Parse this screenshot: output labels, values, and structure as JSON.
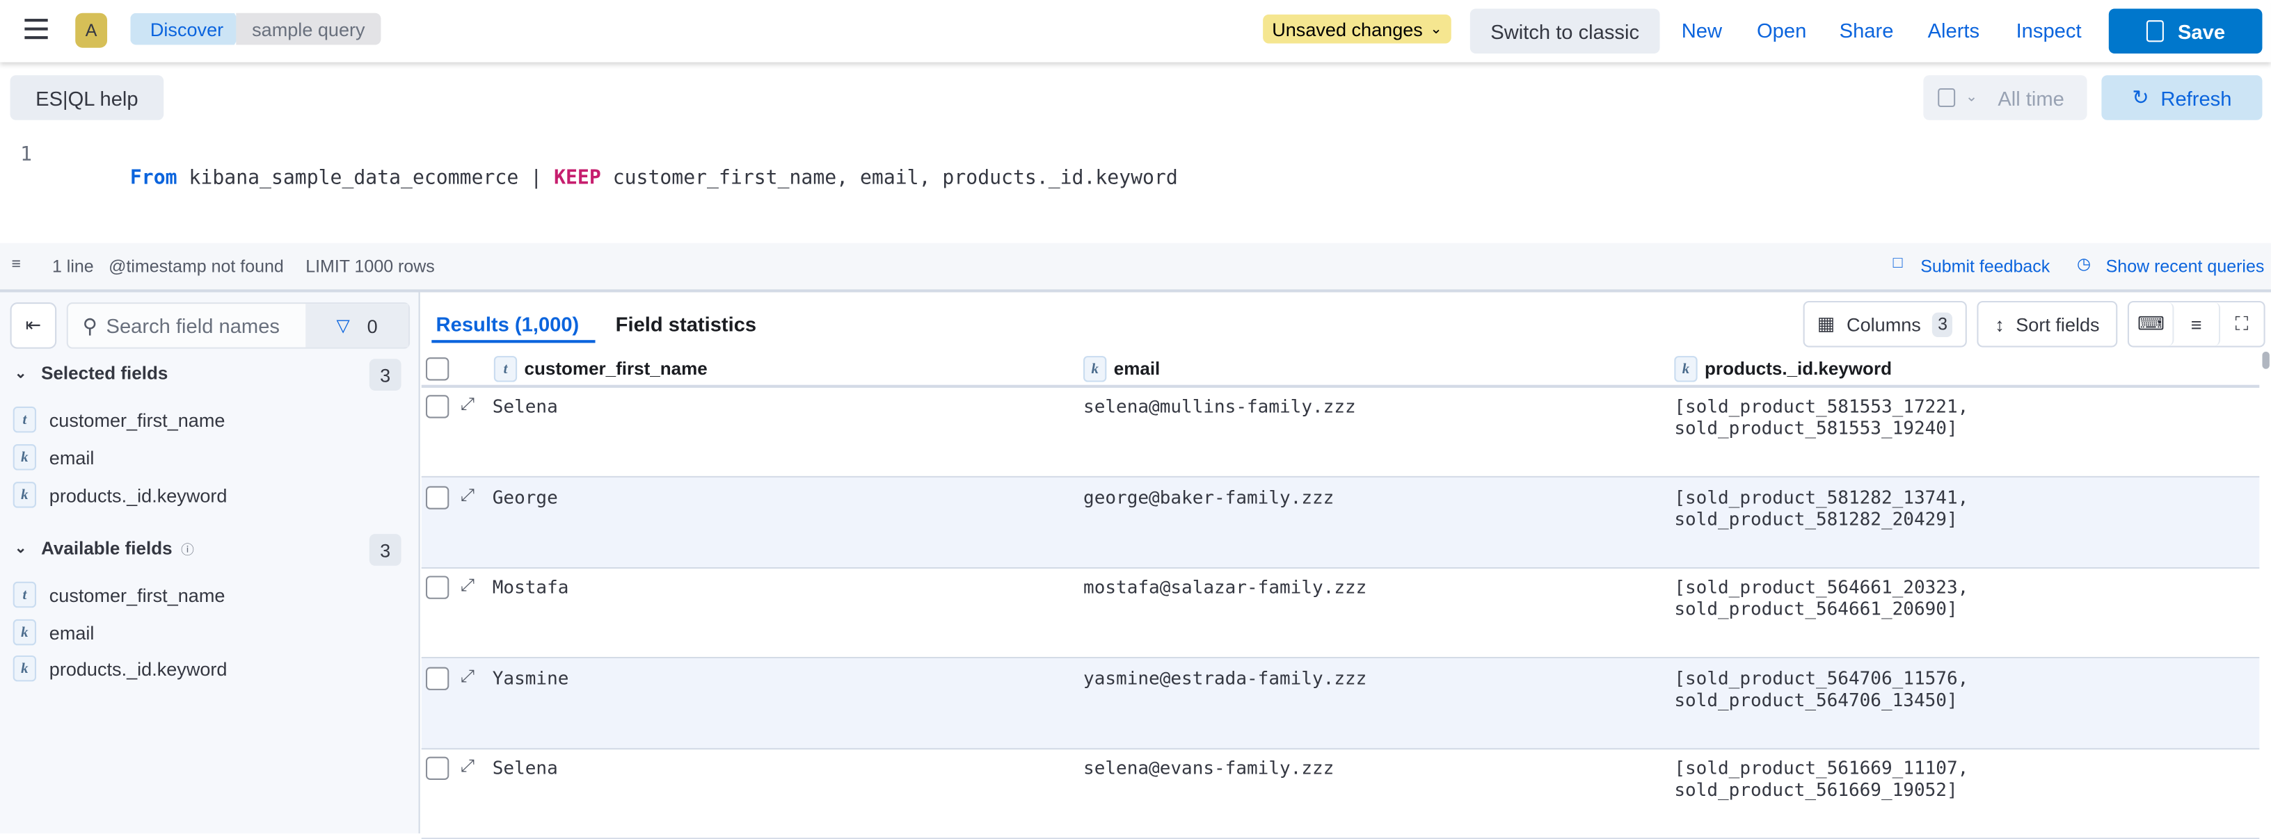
{
  "header": {
    "avatar": "A",
    "breadcrumbs": [
      "Discover",
      "sample query"
    ],
    "unsaved_label": "Unsaved changes",
    "switch_label": "Switch to classic",
    "nav": [
      "New",
      "Open",
      "Share",
      "Alerts",
      "Inspect"
    ],
    "save_label": "Save"
  },
  "toolbar": {
    "help_label": "ES|QL help",
    "time_label": "All time",
    "refresh_label": "Refresh"
  },
  "editor": {
    "line_number": "1",
    "kw_from": "From",
    "source": "kibana_sample_data_ecommerce",
    "pipe": "|",
    "kw_keep": "KEEP",
    "fields": "customer_first_name, email, products._id.keyword"
  },
  "status": {
    "lines": "1 line",
    "timestamp": "@timestamp not found",
    "limit": "LIMIT 1000 rows",
    "feedback": "Submit feedback",
    "recent": "Show recent queries"
  },
  "sidebar": {
    "search_placeholder": "Search field names",
    "filter_count": "0",
    "selected_title": "Selected fields",
    "selected_count": "3",
    "selected": [
      {
        "type": "t",
        "name": "customer_first_name"
      },
      {
        "type": "k",
        "name": "email"
      },
      {
        "type": "k",
        "name": "products._id.keyword"
      }
    ],
    "available_title": "Available fields",
    "available_count": "3",
    "available": [
      {
        "type": "t",
        "name": "customer_first_name"
      },
      {
        "type": "k",
        "name": "email"
      },
      {
        "type": "k",
        "name": "products._id.keyword"
      }
    ]
  },
  "main": {
    "tabs": [
      "Results (1,000)",
      "Field statistics"
    ],
    "columns_label": "Columns",
    "columns_count": "3",
    "sort_label": "Sort fields",
    "headers": [
      {
        "type": "t",
        "name": "customer_first_name"
      },
      {
        "type": "k",
        "name": "email"
      },
      {
        "type": "k",
        "name": "products._id.keyword"
      }
    ],
    "rows": [
      {
        "name": "Selena",
        "email": "selena@mullins-family.zzz",
        "products": "[sold_product_581553_17221, sold_product_581553_19240]"
      },
      {
        "name": "George",
        "email": "george@baker-family.zzz",
        "products": "[sold_product_581282_13741, sold_product_581282_20429]"
      },
      {
        "name": "Mostafa",
        "email": "mostafa@salazar-family.zzz",
        "products": "[sold_product_564661_20323, sold_product_564661_20690]"
      },
      {
        "name": "Yasmine",
        "email": "yasmine@estrada-family.zzz",
        "products": "[sold_product_564706_11576, sold_product_564706_13450]"
      },
      {
        "name": "Selena",
        "email": "selena@evans-family.zzz",
        "products": "[sold_product_561669_11107, sold_product_561669_19052]"
      }
    ]
  },
  "colors": {
    "primary": "#0b64dd",
    "save": "#0077cc",
    "keyword_pink": "#c61e6e",
    "unsaved": "#f5e690",
    "avatar": "#d6bf57"
  }
}
